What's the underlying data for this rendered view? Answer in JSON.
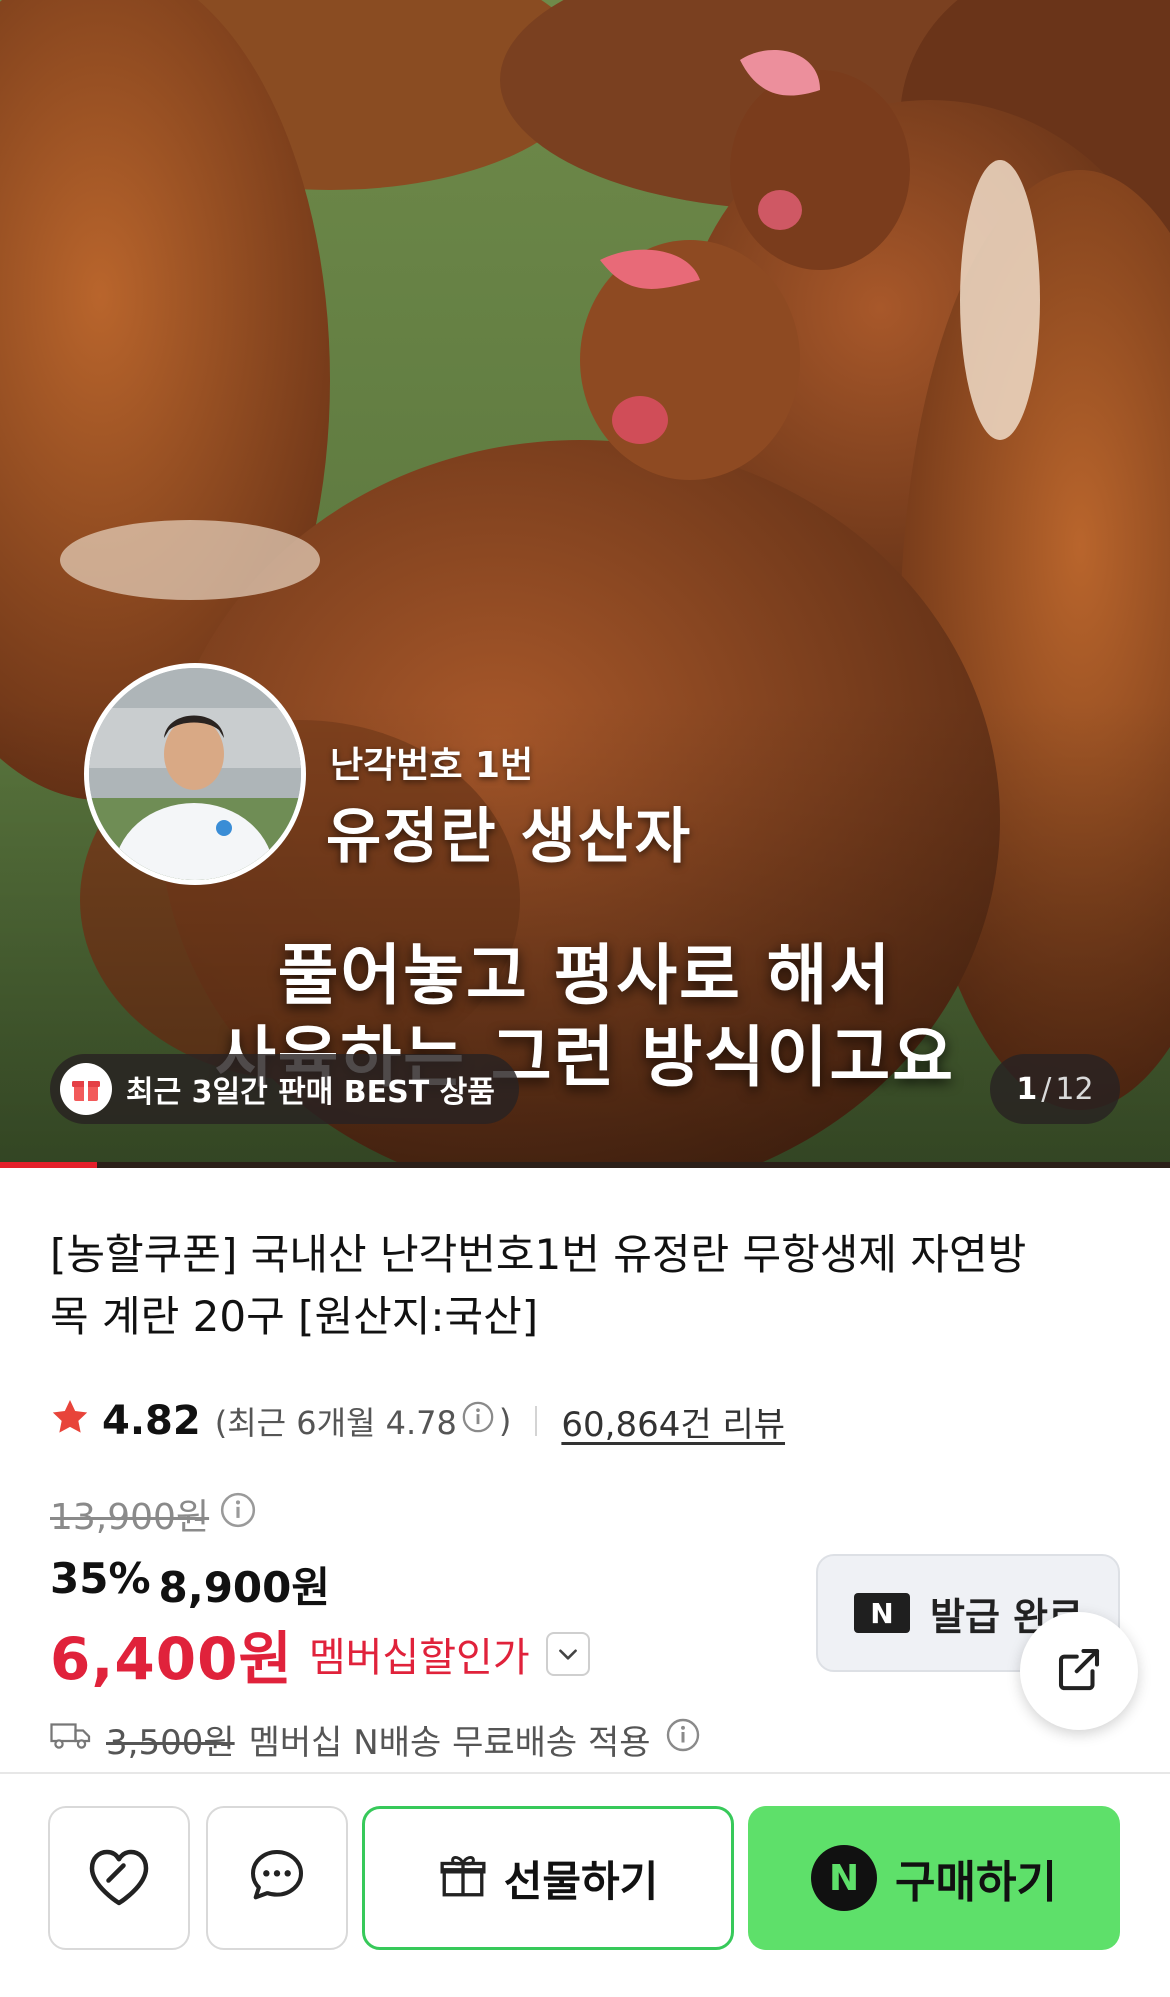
{
  "hero": {
    "producer_tag": "난각번호 1번",
    "producer_name": "유정란 생산자",
    "caption_line1": "풀어놓고 평사로 해서",
    "caption_line2": "사육하는 그런 방식이고요",
    "best_badge": "최근 3일간 판매 BEST 상품",
    "page_current": "1",
    "page_separator": "/",
    "page_total": "12",
    "gallery_progress_fraction": 0.0833
  },
  "product": {
    "title": "[농할쿠폰] 국내산 난각번호1번 유정란 무항생제 자연방목 계란 20구 [원산지:국산]",
    "rating": "4.82",
    "recent_rating": "(최근 6개월 4.78",
    "recent_close": ")",
    "review_count": "60,864건 리뷰",
    "original_price": "13,900원",
    "discount_rate": "35%",
    "sale_price": "8,900원",
    "member_price": "6,400원",
    "member_price_label": "멤버십할인가",
    "coupon_label": "발급 완료",
    "coupon_logo": "N",
    "shipping_fee": "3,500원",
    "shipping_note": "멤버십 N배송 무료배송 적용"
  },
  "actions": {
    "gift_label": "선물하기",
    "buy_logo": "N",
    "buy_label": "구매하기"
  },
  "colors": {
    "accent_red": "#e0223b",
    "buy_green": "#5ee06a",
    "gift_border_green": "#37c95a",
    "star": "#e8443a"
  },
  "icons": [
    "gift-icon",
    "info-icon",
    "star-icon",
    "chevron-down-icon",
    "share-icon",
    "truck-icon",
    "heart-icon",
    "chat-icon",
    "present-icon"
  ]
}
